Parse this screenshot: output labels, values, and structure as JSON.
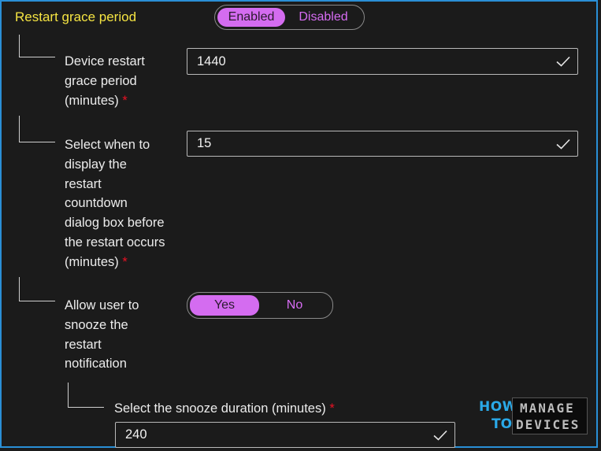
{
  "section": {
    "title": "Restart grace period",
    "toggle": {
      "options": [
        "Enabled",
        "Disabled"
      ],
      "selected": "Enabled"
    }
  },
  "fields": [
    {
      "label_lines": [
        "Device restart",
        "grace period",
        "(minutes)"
      ],
      "required": "*",
      "value": "1440"
    },
    {
      "label_lines": [
        "Select when to",
        "display the",
        "restart",
        "countdown",
        "dialog box before",
        "the restart occurs",
        "(minutes)"
      ],
      "required": "*",
      "value": "15"
    }
  ],
  "snooze": {
    "label_lines": [
      "Allow user to",
      "snooze the",
      "restart",
      "notification"
    ],
    "toggle": {
      "options": [
        "Yes",
        "No"
      ],
      "selected": "Yes"
    }
  },
  "snooze_duration": {
    "label": "Select the snooze duration (minutes)",
    "required": "*",
    "value": "240"
  },
  "logo": {
    "line1": "HOW",
    "line2": "TO",
    "box1": "MANAGE",
    "box2": "DEVICES"
  },
  "icons": {
    "valid": "check-icon"
  },
  "colors": {
    "accent": "#d46cf0",
    "title": "#f5e442",
    "required": "#e81123",
    "border": "#2a8fd6"
  }
}
